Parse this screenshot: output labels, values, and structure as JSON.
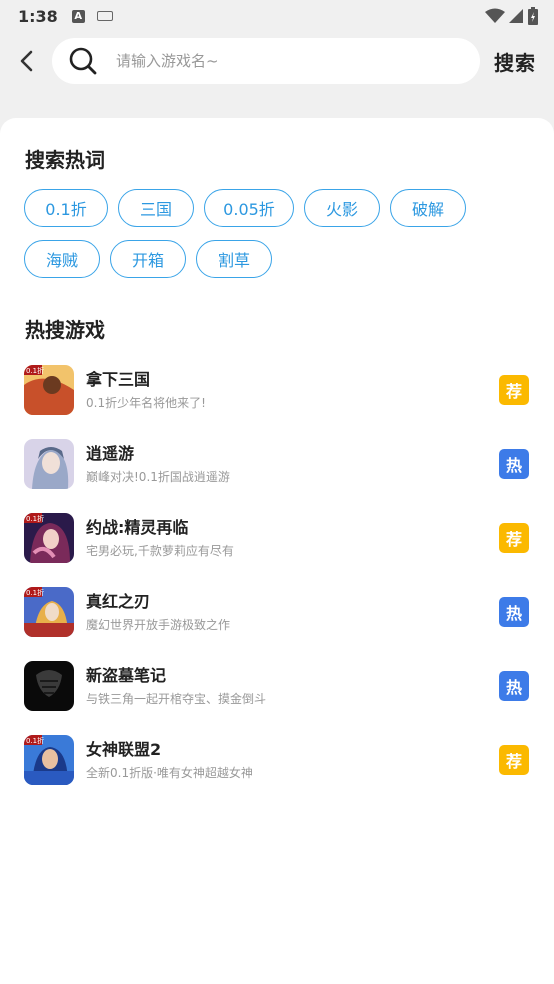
{
  "status_bar": {
    "time": "1:38",
    "a_icon_letter": "A"
  },
  "header": {
    "search_placeholder": "请输入游戏名~",
    "search_button": "搜索"
  },
  "hot_keywords": {
    "title": "搜索热词",
    "rows": [
      [
        "0.1折",
        "三国",
        "0.05折",
        "火影",
        "破解"
      ],
      [
        "海贼",
        "开箱",
        "割草"
      ]
    ]
  },
  "hot_games": {
    "title": "热搜游戏",
    "items": [
      {
        "name": "拿下三国",
        "desc": "0.1折少年名将他来了!",
        "badge": "荐",
        "badge_type": "recommend",
        "icon_colors": [
          "#c8502a",
          "#f2c36b",
          "#6b3a20"
        ]
      },
      {
        "name": "逍遥游",
        "desc": "巅峰对决!0.1折国战逍遥游",
        "badge": "热",
        "badge_type": "hot",
        "icon_colors": [
          "#d8d3e8",
          "#9aa8c8",
          "#5a6a8a"
        ]
      },
      {
        "name": "约战:精灵再临",
        "desc": "宅男必玩,千款萝莉应有尽有",
        "badge": "荐",
        "badge_type": "recommend",
        "icon_colors": [
          "#7a2a5a",
          "#e38fb5",
          "#2a1a4a"
        ]
      },
      {
        "name": "真红之刃",
        "desc": "魔幻世界开放手游极致之作",
        "badge": "热",
        "badge_type": "hot",
        "icon_colors": [
          "#e8b04a",
          "#4a6ac8",
          "#b0302a"
        ]
      },
      {
        "name": "新盗墓笔记",
        "desc": "与铁三角一起开棺夺宝、摸金倒斗",
        "badge": "热",
        "badge_type": "hot",
        "icon_colors": [
          "#1a1a1a",
          "#3a3a3a",
          "#0a0a0a"
        ]
      },
      {
        "name": "女神联盟2",
        "desc": "全新0.1折版·唯有女神超越女神",
        "badge": "荐",
        "badge_type": "recommend",
        "icon_colors": [
          "#3a7ad8",
          "#e8c0a0",
          "#1a3a8a"
        ]
      }
    ]
  },
  "colors": {
    "accent": "#2c98e0",
    "badge_recommend": "#fbb900",
    "badge_hot": "#3d7be8"
  }
}
